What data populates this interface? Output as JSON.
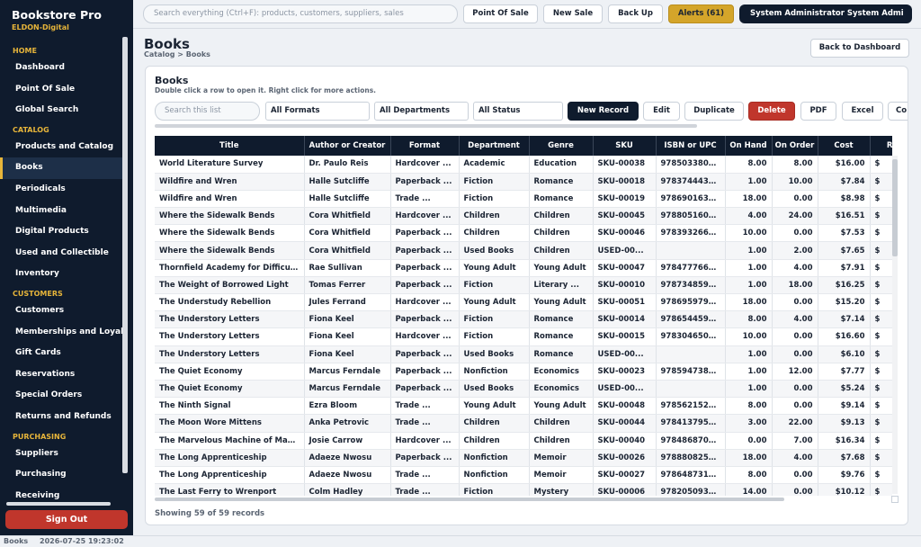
{
  "app": {
    "title": "Bookstore Pro",
    "subtitle": "ELDON-Digital"
  },
  "topbar": {
    "search_placeholder": "Search everything (Ctrl+F): products, customers, suppliers, sales",
    "point_of_sale": "Point Of Sale",
    "new_sale": "New Sale",
    "back_up": "Back Up",
    "alerts": "Alerts (61)",
    "user": "System Administrator  System Admi"
  },
  "sidebar": {
    "sections": [
      {
        "title": "HOME",
        "items": [
          "Dashboard",
          "Point Of Sale",
          "Global Search"
        ]
      },
      {
        "title": "CATALOG",
        "items": [
          "Products and Catalog",
          "Books",
          "Periodicals",
          "Multimedia",
          "Digital Products",
          "Used and Collectible",
          "Inventory"
        ]
      },
      {
        "title": "CUSTOMERS",
        "items": [
          "Customers",
          "Memberships and Loyalty",
          "Gift Cards",
          "Reservations",
          "Special Orders",
          "Returns and Refunds"
        ]
      },
      {
        "title": "PURCHASING",
        "items": [
          "Suppliers",
          "Purchasing",
          "Receiving"
        ]
      }
    ],
    "active": "Books",
    "sign_out": "Sign Out"
  },
  "page": {
    "title": "Books",
    "breadcrumb": "Catalog  >  Books",
    "back_to_dashboard": "Back to Dashboard"
  },
  "card": {
    "title": "Books",
    "hint": "Double click a row to open it. Right click for more actions."
  },
  "toolbar": {
    "search_placeholder": "Search this list",
    "format": "All Formats",
    "department": "All Departments",
    "status": "All Status",
    "new_record": "New Record",
    "edit": "Edit",
    "duplicate": "Duplicate",
    "delete": "Delete",
    "pdf": "PDF",
    "excel": "Excel",
    "more": "Co"
  },
  "table": {
    "columns": [
      "Title",
      "Author or Creator",
      "Format",
      "Department",
      "Genre",
      "SKU",
      "ISBN or UPC",
      "On Hand",
      "On Order",
      "Cost",
      "Re"
    ],
    "rows": [
      [
        "World Literature Survey",
        "Dr. Paulo Reis",
        "Hardcover ...",
        "Academic",
        "Education",
        "SKU-00038",
        "9785033807...",
        "8.00",
        "8.00",
        "$16.00",
        "$"
      ],
      [
        "Wildfire and Wren",
        "Halle Sutcliffe",
        "Paperback ...",
        "Fiction",
        "Romance",
        "SKU-00018",
        "9783744433...",
        "1.00",
        "10.00",
        "$7.84",
        "$"
      ],
      [
        "Wildfire and Wren",
        "Halle Sutcliffe",
        "Trade ...",
        "Fiction",
        "Romance",
        "SKU-00019",
        "9786901630...",
        "18.00",
        "0.00",
        "$8.98",
        "$"
      ],
      [
        "Where the Sidewalk Bends",
        "Cora Whitfield",
        "Hardcover ...",
        "Children",
        "Children",
        "SKU-00045",
        "9788051609...",
        "4.00",
        "24.00",
        "$16.51",
        "$"
      ],
      [
        "Where the Sidewalk Bends",
        "Cora Whitfield",
        "Paperback ...",
        "Children",
        "Children",
        "SKU-00046",
        "9783932665...",
        "10.00",
        "0.00",
        "$7.53",
        "$"
      ],
      [
        "Where the Sidewalk Bends",
        "Cora Whitfield",
        "Paperback ...",
        "Used Books",
        "Children",
        "USED-00...",
        "",
        "1.00",
        "2.00",
        "$7.65",
        "$"
      ],
      [
        "Thornfield Academy for Difficult Girls",
        "Rae Sullivan",
        "Paperback ...",
        "Young Adult",
        "Young Adult",
        "SKU-00047",
        "9784777664...",
        "1.00",
        "4.00",
        "$7.91",
        "$"
      ],
      [
        "The Weight of Borrowed Light",
        "Tomas Ferrer",
        "Paperback ...",
        "Fiction",
        "Literary ...",
        "SKU-00010",
        "9787348592...",
        "1.00",
        "18.00",
        "$16.25",
        "$"
      ],
      [
        "The Understudy Rebellion",
        "Jules Ferrand",
        "Hardcover ...",
        "Young Adult",
        "Young Adult",
        "SKU-00051",
        "9786959790...",
        "18.00",
        "0.00",
        "$15.20",
        "$"
      ],
      [
        "The Understory Letters",
        "Fiona Keel",
        "Paperback ...",
        "Fiction",
        "Romance",
        "SKU-00014",
        "9786544590...",
        "8.00",
        "4.00",
        "$7.14",
        "$"
      ],
      [
        "The Understory Letters",
        "Fiona Keel",
        "Hardcover ...",
        "Fiction",
        "Romance",
        "SKU-00015",
        "9783046500...",
        "10.00",
        "0.00",
        "$16.60",
        "$"
      ],
      [
        "The Understory Letters",
        "Fiona Keel",
        "Paperback ...",
        "Used Books",
        "Romance",
        "USED-00...",
        "",
        "1.00",
        "0.00",
        "$6.10",
        "$"
      ],
      [
        "The Quiet Economy",
        "Marcus Ferndale",
        "Paperback ...",
        "Nonfiction",
        "Economics",
        "SKU-00023",
        "9785947381...",
        "1.00",
        "12.00",
        "$7.77",
        "$"
      ],
      [
        "The Quiet Economy",
        "Marcus Ferndale",
        "Paperback ...",
        "Used Books",
        "Economics",
        "USED-00...",
        "",
        "1.00",
        "0.00",
        "$5.24",
        "$"
      ],
      [
        "The Ninth Signal",
        "Ezra Bloom",
        "Trade ...",
        "Young Adult",
        "Young Adult",
        "SKU-00048",
        "9785621528...",
        "8.00",
        "0.00",
        "$9.14",
        "$"
      ],
      [
        "The Moon Wore Mittens",
        "Anka Petrovic",
        "Trade ...",
        "Children",
        "Children",
        "SKU-00044",
        "9784137953...",
        "3.00",
        "22.00",
        "$9.13",
        "$"
      ],
      [
        "The Marvelous Machine of Mabel Quill",
        "Josie Carrow",
        "Hardcover ...",
        "Children",
        "Children",
        "SKU-00040",
        "9784868700...",
        "0.00",
        "7.00",
        "$16.34",
        "$"
      ],
      [
        "The Long Apprenticeship",
        "Adaeze Nwosu",
        "Paperback ...",
        "Nonfiction",
        "Memoir",
        "SKU-00026",
        "9788808257...",
        "18.00",
        "4.00",
        "$7.68",
        "$"
      ],
      [
        "The Long Apprenticeship",
        "Adaeze Nwosu",
        "Trade ...",
        "Nonfiction",
        "Memoir",
        "SKU-00027",
        "9786487311...",
        "8.00",
        "0.00",
        "$9.76",
        "$"
      ],
      [
        "The Last Ferry to Wrenport",
        "Colm Hadley",
        "Trade ...",
        "Fiction",
        "Mystery",
        "SKU-00006",
        "9782050934...",
        "14.00",
        "0.00",
        "$10.12",
        "$"
      ]
    ],
    "record_count": "Showing 59 of 59 records"
  },
  "statusbar": {
    "left": "Books",
    "timestamp": "2026-07-25 19:23:02"
  },
  "colors": {
    "navy": "#0f1b2d",
    "gold": "#e7b53a",
    "danger": "#c0362c",
    "alert": "#d4a52a"
  }
}
